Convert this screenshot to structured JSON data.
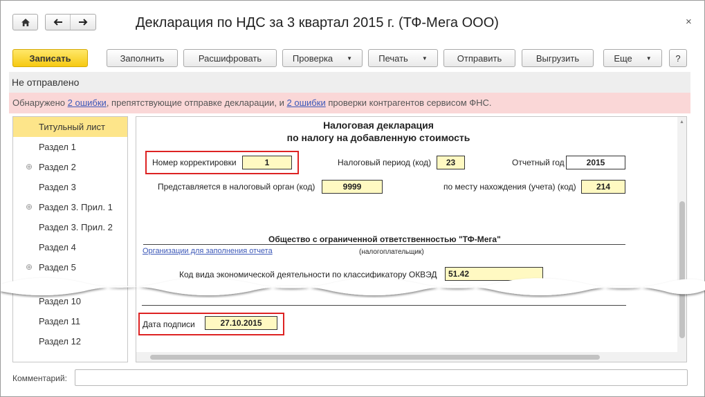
{
  "window": {
    "title": "Декларация по НДС за 3 квартал 2015 г. (ТФ-Мега ООО)",
    "close_glyph": "×"
  },
  "nav": {
    "home_icon": "home-icon",
    "back_glyph": "🡐",
    "forward_glyph": "🡒"
  },
  "toolbar": {
    "save": "Записать",
    "fill": "Заполнить",
    "decode": "Расшифровать",
    "check": "Проверка",
    "print": "Печать",
    "send": "Отправить",
    "export": "Выгрузить",
    "more": "Еще",
    "help": "?",
    "dropdown_glyph": "▼"
  },
  "status": {
    "text": "Не отправлено"
  },
  "errors": {
    "prefix": "Обнаружено ",
    "link1": "2 ошибки",
    "middle": ", препятствующие отправке декларации, и ",
    "link2": "2 ошибки",
    "suffix": " проверки контрагентов сервисом ФНС."
  },
  "sidebar": {
    "plus_glyph": "⊕",
    "items": [
      {
        "label": "Титульный лист"
      },
      {
        "label": "Раздел 1"
      },
      {
        "label": "Раздел 2"
      },
      {
        "label": "Раздел 3"
      },
      {
        "label": "Раздел 3. Прил. 1"
      },
      {
        "label": "Раздел 3. Прил. 2"
      },
      {
        "label": "Раздел 4"
      },
      {
        "label": "Раздел 5"
      },
      {
        "label": "Раздел 10"
      },
      {
        "label": "Раздел 11"
      },
      {
        "label": "Раздел 12"
      }
    ]
  },
  "form": {
    "heading_line1": "Налоговая декларация",
    "heading_line2": "по налогу на добавленную стоимость",
    "correction_label": "Номер корректировки",
    "correction_value": "1",
    "period_label": "Налоговый период (код)",
    "period_value": "23",
    "year_label": "Отчетный год",
    "year_value": "2015",
    "authority_label": "Представляется в налоговый орган (код)",
    "authority_value": "9999",
    "location_label": "по месту нахождения (учета) (код)",
    "location_value": "214",
    "org_name": "Общество с ограниченной ответственностью \"ТФ-Мега\"",
    "org_link": "Организации для заполнения отчета",
    "taxpayer_caption": "(налогоплательщик)",
    "okved_label": "Код вида экономической деятельности по классификатору ОКВЭД",
    "okved_value": "51.42",
    "sign_date_label": "Дата подписи",
    "sign_date_value": "27.10.2015"
  },
  "comment": {
    "label": "Комментарий:",
    "value": ""
  }
}
